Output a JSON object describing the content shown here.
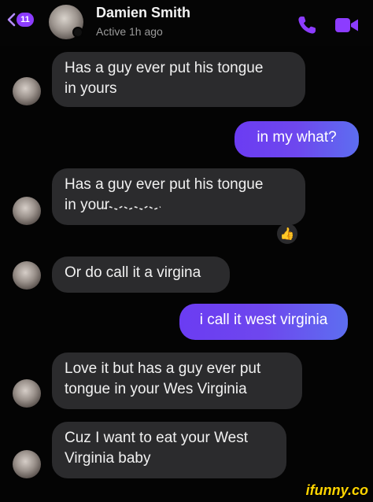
{
  "header": {
    "back_badge": "11",
    "contact_name": "Damien Smith",
    "status": "Active 1h ago",
    "back_icon": "chevron-left-icon",
    "call_icon": "phone-icon",
    "video_icon": "video-camera-icon",
    "accent_color": "#8c3cff"
  },
  "messages": [
    {
      "from": "them",
      "text": "Has a guy ever put his tongue\nin yours"
    },
    {
      "from": "me",
      "text": "in my what?"
    },
    {
      "from": "them",
      "text": "Has a guy ever put his tongue\nin your"
    },
    {
      "from": "them",
      "text": "Or do call it a virgina"
    },
    {
      "from": "me",
      "text": "i call it west virginia"
    },
    {
      "from": "them",
      "text": "Love it but has a guy ever put\ntongue in your Wes Virginia"
    },
    {
      "from": "them",
      "text": "Cuz I want to eat your West\nVirginia baby"
    }
  ],
  "reaction": {
    "emoji": "👍",
    "icon": "thumbs-up-icon"
  },
  "watermark": "ifunny.co",
  "colors": {
    "incoming_bubble": "#2b2b2d",
    "outgoing_bubble_start": "#6b3cf2",
    "outgoing_bubble_end": "#5d6ef0",
    "background": "#040404"
  }
}
